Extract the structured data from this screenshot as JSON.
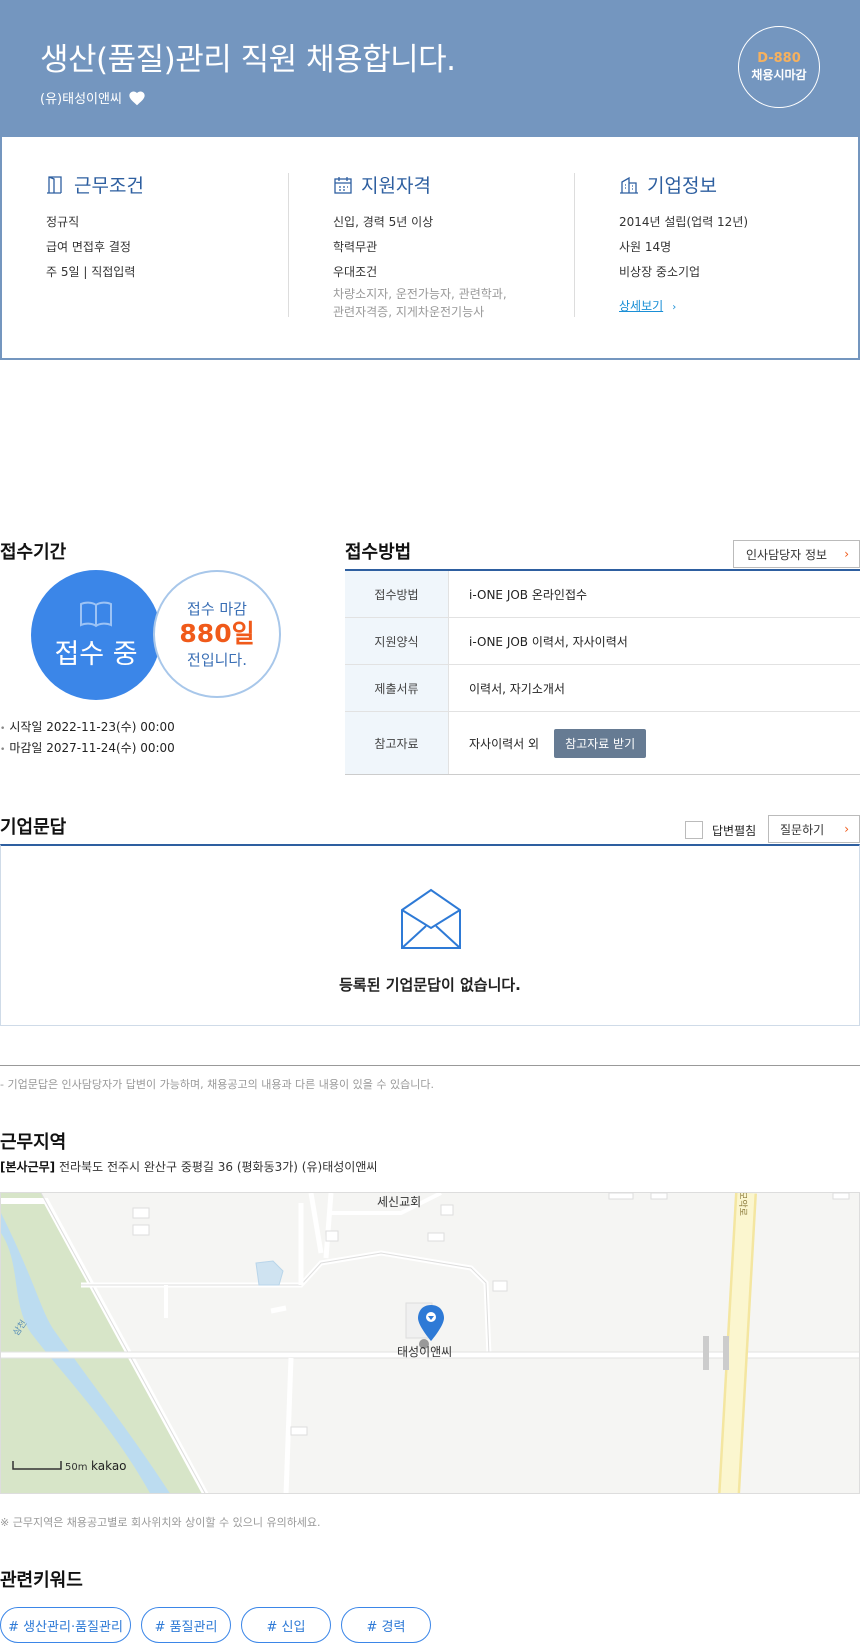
{
  "header": {
    "title": "생산(품질)관리 직원 채용합니다.",
    "company": "(유)태성이앤씨",
    "dday": "D-880",
    "dday_label": "채용시마감"
  },
  "summary": {
    "work": {
      "title": "근무조건",
      "lines": [
        "정규직",
        "급여 면접후 결정",
        "주 5일 | 직접입력"
      ]
    },
    "qualification": {
      "title": "지원자격",
      "lines": [
        "신입, 경력 5년 이상",
        "학력무관",
        "우대조건"
      ],
      "sub": [
        "차량소지자, 운전가능자, 관련학과,",
        "관련자격증, 지게차운전기능사"
      ]
    },
    "company_info": {
      "title": "기업정보",
      "lines": [
        "2014년 설립(업력 12년)",
        "사원 14명",
        "비상장 중소기업"
      ],
      "link": "상세보기"
    }
  },
  "period": {
    "heading": "접수기간",
    "status": "접수 중",
    "deadline_prefix": "접수 마감",
    "days_left": "880일",
    "deadline_suffix": "전입니다.",
    "start": "시작일 2022-11-23(수) 00:00",
    "end": "마감일 2027-11-24(수) 00:00"
  },
  "apply": {
    "heading": "접수방법",
    "hr_button": "인사담당자 정보",
    "rows": [
      {
        "label": "접수방법",
        "value": "i-ONE JOB 온라인접수"
      },
      {
        "label": "지원양식",
        "value": "i-ONE JOB 이력서, 자사이력서"
      },
      {
        "label": "제출서류",
        "value": "이력서, 자기소개서"
      },
      {
        "label": "참고자료",
        "value": "자사이력서 외",
        "button": "참고자료 받기"
      }
    ]
  },
  "qa": {
    "heading": "기업문답",
    "toggle_label": "답변펼침",
    "ask_button": "질문하기",
    "empty_text": "등록된 기업문답이 없습니다.",
    "note": "- 기업문답은 인사담당자가 답변이 가능하며, 채용공고의 내용과 다른 내용이 있을 수 있습니다."
  },
  "location": {
    "heading": "근무지역",
    "tag": "[본사근무]",
    "address": "전라북도 전주시 완산구 중평길 36 (평화동3가) (유)태성이앤씨",
    "map": {
      "church_label": "세신교회",
      "company_label": "태성이앤씨",
      "river_label": "삼천",
      "road_label": "모악로",
      "scale": "50m",
      "provider": "kakao"
    },
    "note": "※ 근무지역은 채용공고별로 회사위치와 상이할 수 있으니 유의하세요."
  },
  "keywords": {
    "heading": "관련키워드",
    "items": [
      "# 생산관리·품질관리",
      "# 품질관리",
      "# 신입",
      "# 경력"
    ]
  }
}
